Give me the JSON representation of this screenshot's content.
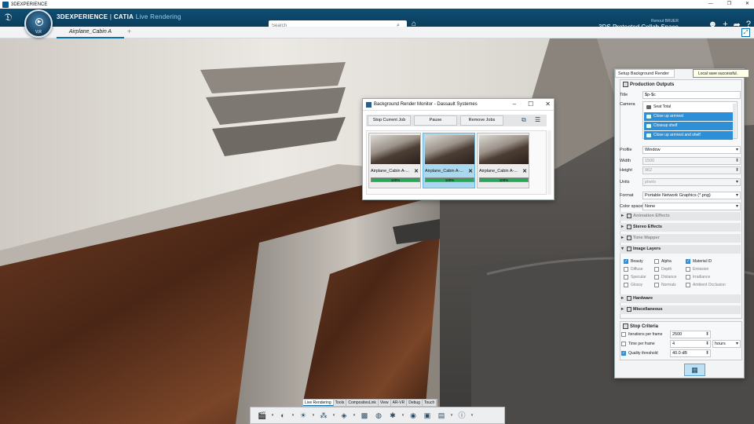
{
  "window": {
    "title": "3DEXPERIENCE",
    "controls": [
      "—",
      "❐",
      "✕"
    ]
  },
  "appbar": {
    "logo": "3DS",
    "brand_bold": "3DEXPERIENCE",
    "brand_sep": " | ",
    "brand_app": "CATIA",
    "brand_module": " Live Rendering",
    "compass_label": "V,R",
    "search_placeholder": "Search",
    "user_name": "Renout BRUER",
    "space": "3DS Protected Collab Space"
  },
  "tab": {
    "label": "Airplane_Cabin A"
  },
  "render_monitor": {
    "title": "Background Render Monitor - Dassault Systemes",
    "buttons": [
      "Stop Current Job",
      "Pause",
      "Remove Jobs"
    ],
    "jobs": [
      {
        "name": "Airplane_Cabin A-...",
        "progress": "100%",
        "selected": false
      },
      {
        "name": "Airplane_Cabin A-...",
        "progress": "100%",
        "selected": true
      },
      {
        "name": "Airplane_Cabin A-...",
        "progress": "100%",
        "selected": false
      }
    ]
  },
  "panel": {
    "tab": "Setup Background Render",
    "toast": "Local save successful.",
    "production_outputs": "Production Outputs",
    "title_label": "Title",
    "title_value": "$p-$c",
    "camera_label": "Camera",
    "cameras": [
      {
        "name": "Seat Total",
        "selected": false
      },
      {
        "name": "Close up armrest",
        "selected": true
      },
      {
        "name": "Closeup shelf",
        "selected": true
      },
      {
        "name": "Close up armrest and shelf",
        "selected": true
      }
    ],
    "profile_label": "Profile",
    "profile_value": "Window",
    "width_label": "Width",
    "width_value": "1500",
    "height_label": "Height",
    "height_value": "962",
    "units_label": "Units",
    "units_value": "pixels",
    "format_label": "Format",
    "format_value": "Portable Network Graphics (*.png)",
    "colorspace_label": "Color space",
    "colorspace_value": "None",
    "sections": {
      "animation": "Animation Effects",
      "stereo": "Stereo Effects",
      "tone": "Tone Mapper",
      "image_layers": "Image Layers",
      "hardware": "Hardware",
      "misc": "Miscellaneous"
    },
    "layers": [
      {
        "name": "Beauty",
        "on": true,
        "dim": false
      },
      {
        "name": "Alpha",
        "on": false,
        "dim": false
      },
      {
        "name": "Material ID",
        "on": true,
        "dim": false
      },
      {
        "name": "Diffuse",
        "on": false,
        "dim": true
      },
      {
        "name": "Depth",
        "on": false,
        "dim": true
      },
      {
        "name": "Emission",
        "on": false,
        "dim": true
      },
      {
        "name": "Specular",
        "on": false,
        "dim": true
      },
      {
        "name": "Distance",
        "on": false,
        "dim": true
      },
      {
        "name": "Irradiance",
        "on": false,
        "dim": true
      },
      {
        "name": "Glossy",
        "on": false,
        "dim": true
      },
      {
        "name": "Normals",
        "on": false,
        "dim": true
      },
      {
        "name": "Ambient Occlusion",
        "on": false,
        "dim": true
      }
    ],
    "stop_criteria": "Stop Criteria",
    "iter_label": "Iterations per frame",
    "iter_value": "2500",
    "time_label": "Time per frame",
    "time_value": "4",
    "time_unit": "hours",
    "quality_label": "Quality threshold",
    "quality_value": "40.0 dB"
  },
  "bottom_tabs": [
    "Live Rendering",
    "Tools",
    "CompositesLink",
    "View",
    "AR-VR",
    "Debug",
    "Touch"
  ],
  "colors": {
    "accent": "#0b6fa8",
    "appbar": "#0a3d5c",
    "selection": "#2d8fd5",
    "progress": "#2aa65a"
  }
}
